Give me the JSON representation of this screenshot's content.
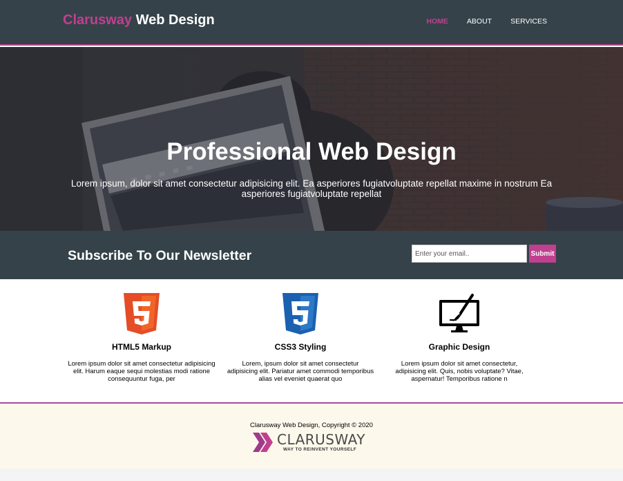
{
  "header": {
    "brand_accent": "Clarusway",
    "brand_rest": " Web Design",
    "nav": [
      {
        "label": "HOME",
        "active": true
      },
      {
        "label": "ABOUT",
        "active": false
      },
      {
        "label": "SERVICES",
        "active": false
      }
    ]
  },
  "hero": {
    "title": "Professional Web Design",
    "subtitle": "Lorem ipsum, dolor sit amet consectetur adipisicing elit. Ea asperiores fugiatvoluptate repellat maxime in nostrum Ea asperiores fugiatvoluptate repellat"
  },
  "newsletter": {
    "title": "Subscribe To Our Newsletter",
    "email_placeholder": "Enter your email..",
    "submit_label": "Submit"
  },
  "boxes": [
    {
      "icon": "html5-icon",
      "title": "HTML5 Markup",
      "text": "Lorem ipsum dolor sit amet consectetur adipisicing elit. Harum eaque sequi molestias modi ratione consequuntur fuga, per"
    },
    {
      "icon": "css3-icon",
      "title": "CSS3 Styling",
      "text": "Lorem, ipsum dolor sit amet consectetur adipisicing elit. Pariatur amet commodi temporibus alias vel eveniet quaerat quo"
    },
    {
      "icon": "graphic-design-icon",
      "title": "Graphic Design",
      "text": "Lorem ipsum dolor sit amet consectetur, adipisicing elit. Quis, nobis voluptate? Vitae, aspernatur! Temporibus ratione n"
    }
  ],
  "footer": {
    "copyright": "Clarusway Web Design, Copyright © 2020",
    "logo_name": "CLARUSWAY",
    "logo_tagline": "WAY TO REINVENT YOURSELF"
  },
  "colors": {
    "header_bg": "#35424a",
    "accent": "#c0408f",
    "footer_bg": "#fdf8ec",
    "footer_border": "#a14b9b"
  }
}
